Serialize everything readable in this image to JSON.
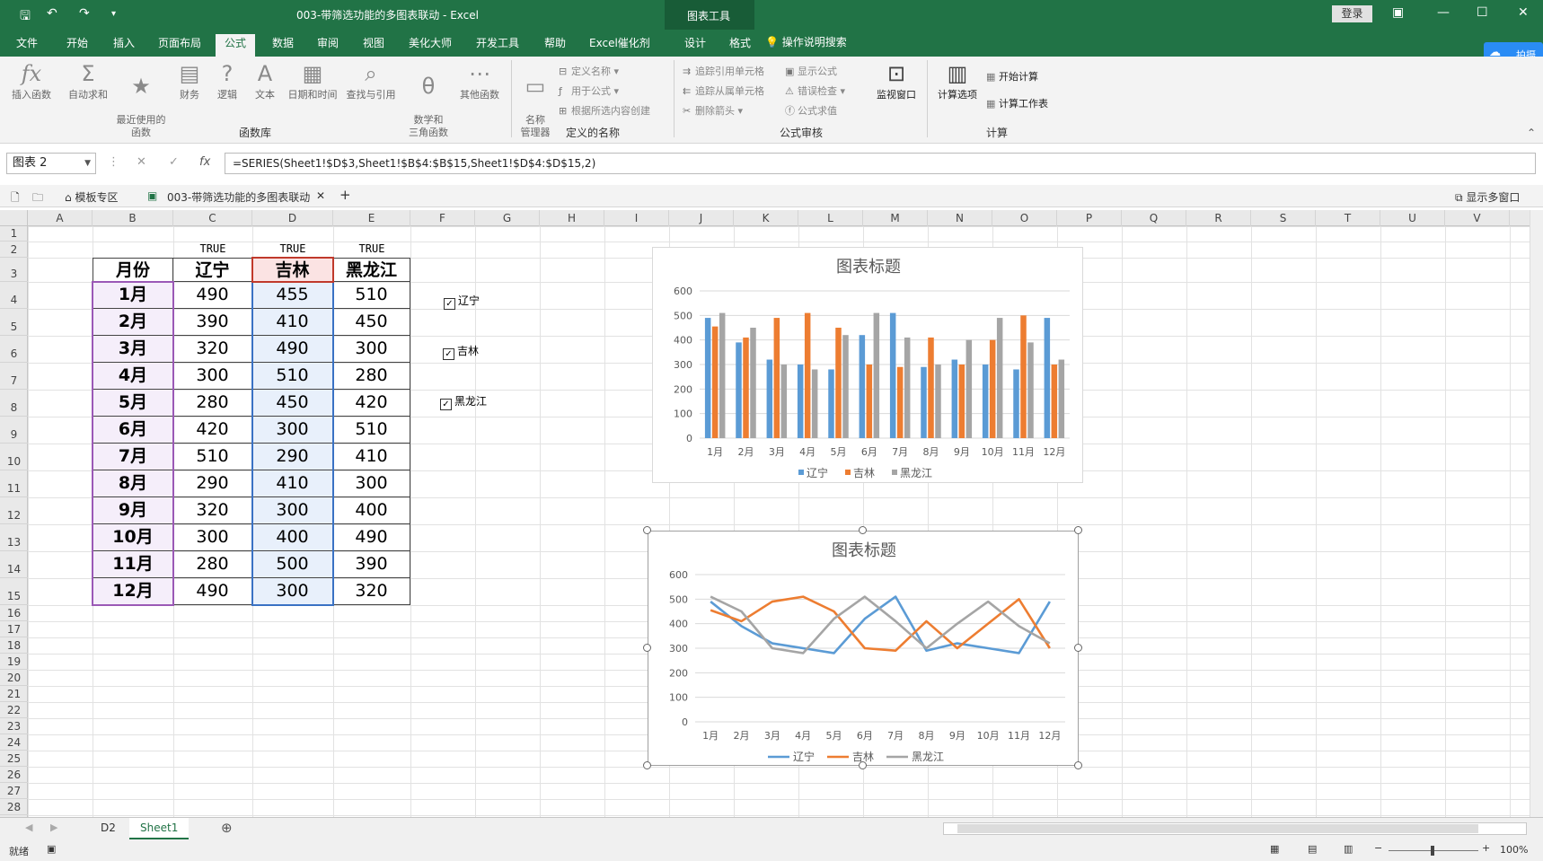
{
  "window": {
    "title": "003-带筛选功能的多图表联动  -  Excel",
    "context_tab_header": "图表工具",
    "login": "登录"
  },
  "tabs": [
    "文件",
    "开始",
    "插入",
    "页面布局",
    "公式",
    "数据",
    "审阅",
    "视图",
    "美化大师",
    "开发工具",
    "帮助",
    "Excel催化剂",
    "设计",
    "格式"
  ],
  "active_tab": "公式",
  "tell_me": "操作说明搜索",
  "cloud_badge": "拍摄",
  "ribbon": {
    "function_library": {
      "label": "函数库",
      "buttons": [
        "插入函数",
        "自动求和",
        "最近使用的\n函数",
        "财务",
        "逻辑",
        "文本",
        "日期和时间",
        "查找与引用",
        "数学和\n三角函数",
        "其他函数"
      ]
    },
    "defined_names": {
      "label": "定义的名称",
      "manager": "名称\n管理器",
      "items": [
        "定义名称",
        "用于公式",
        "根据所选内容创建"
      ]
    },
    "formula_auditing": {
      "label": "公式审核",
      "items": [
        "追踪引用单元格",
        "追踪从属单元格",
        "删除箭头",
        "显示公式",
        "错误检查",
        "公式求值"
      ],
      "watch": "监视窗口"
    },
    "calculation": {
      "label": "计算",
      "options": "计算选项",
      "items": [
        "开始计算",
        "计算工作表"
      ]
    }
  },
  "formula_bar": {
    "name_box": "图表 2",
    "formula": "=SERIES(Sheet1!$D$3,Sheet1!$B$4:$B$15,Sheet1!$D$4:$D$15,2)"
  },
  "workbook_tabs": {
    "template": "模板专区",
    "file": "003-带筛选功能的多图表联动",
    "show_window": "显示多窗口"
  },
  "columns": [
    "A",
    "B",
    "C",
    "D",
    "E",
    "F",
    "G",
    "H",
    "I",
    "J",
    "K",
    "L",
    "M",
    "N",
    "O",
    "P",
    "Q",
    "R",
    "S",
    "T",
    "U",
    "V"
  ],
  "rows": [
    "1",
    "2",
    "3",
    "4",
    "5",
    "6",
    "7",
    "8",
    "9",
    "10",
    "11",
    "12",
    "13",
    "14",
    "15",
    "16",
    "17",
    "18",
    "19",
    "20",
    "21",
    "22",
    "23",
    "24",
    "25",
    "26",
    "27",
    "28"
  ],
  "table": {
    "flags": [
      "TRUE",
      "TRUE",
      "TRUE"
    ],
    "headers": [
      "月份",
      "辽宁",
      "吉林",
      "黑龙江"
    ],
    "rows": [
      [
        "1月",
        "490",
        "455",
        "510"
      ],
      [
        "2月",
        "390",
        "410",
        "450"
      ],
      [
        "3月",
        "320",
        "490",
        "300"
      ],
      [
        "4月",
        "300",
        "510",
        "280"
      ],
      [
        "5月",
        "280",
        "450",
        "420"
      ],
      [
        "6月",
        "420",
        "300",
        "510"
      ],
      [
        "7月",
        "510",
        "290",
        "410"
      ],
      [
        "8月",
        "290",
        "410",
        "300"
      ],
      [
        "9月",
        "320",
        "300",
        "400"
      ],
      [
        "10月",
        "300",
        "400",
        "490"
      ],
      [
        "11月",
        "280",
        "500",
        "390"
      ],
      [
        "12月",
        "490",
        "300",
        "320"
      ]
    ]
  },
  "checkboxes": [
    {
      "label": "辽宁",
      "checked": true
    },
    {
      "label": "吉林",
      "checked": true
    },
    {
      "label": "黑龙江",
      "checked": true
    }
  ],
  "chart_data": [
    {
      "type": "bar",
      "title": "图表标题",
      "categories": [
        "1月",
        "2月",
        "3月",
        "4月",
        "5月",
        "6月",
        "7月",
        "8月",
        "9月",
        "10月",
        "11月",
        "12月"
      ],
      "series": [
        {
          "name": "辽宁",
          "color": "#5b9bd5",
          "values": [
            490,
            390,
            320,
            300,
            280,
            420,
            510,
            290,
            320,
            300,
            280,
            490
          ]
        },
        {
          "name": "吉林",
          "color": "#ed7d31",
          "values": [
            455,
            410,
            490,
            510,
            450,
            300,
            290,
            410,
            300,
            400,
            500,
            300
          ]
        },
        {
          "name": "黑龙江",
          "color": "#a5a5a5",
          "values": [
            510,
            450,
            300,
            280,
            420,
            510,
            410,
            300,
            400,
            490,
            390,
            320
          ]
        }
      ],
      "ylim": [
        0,
        600
      ],
      "yticks": [
        "0",
        "100",
        "200",
        "300",
        "400",
        "500",
        "600"
      ],
      "legend": "bottom",
      "grid": true
    },
    {
      "type": "line",
      "title": "图表标题",
      "categories": [
        "1月",
        "2月",
        "3月",
        "4月",
        "5月",
        "6月",
        "7月",
        "8月",
        "9月",
        "10月",
        "11月",
        "12月"
      ],
      "series": [
        {
          "name": "辽宁",
          "color": "#5b9bd5",
          "values": [
            490,
            390,
            320,
            300,
            280,
            420,
            510,
            290,
            320,
            300,
            280,
            490
          ]
        },
        {
          "name": "吉林",
          "color": "#ed7d31",
          "values": [
            455,
            410,
            490,
            510,
            450,
            300,
            290,
            410,
            300,
            400,
            500,
            300
          ]
        },
        {
          "name": "黑龙江",
          "color": "#a5a5a5",
          "values": [
            510,
            450,
            300,
            280,
            420,
            510,
            410,
            300,
            400,
            490,
            390,
            320
          ]
        }
      ],
      "ylim": [
        0,
        600
      ],
      "yticks": [
        "0",
        "100",
        "200",
        "300",
        "400",
        "500",
        "600"
      ],
      "legend": "bottom",
      "grid": true
    }
  ],
  "sheets": [
    "D2",
    "Sheet1"
  ],
  "active_sheet": "Sheet1",
  "status": {
    "ready": "就绪",
    "zoom": "100%"
  }
}
